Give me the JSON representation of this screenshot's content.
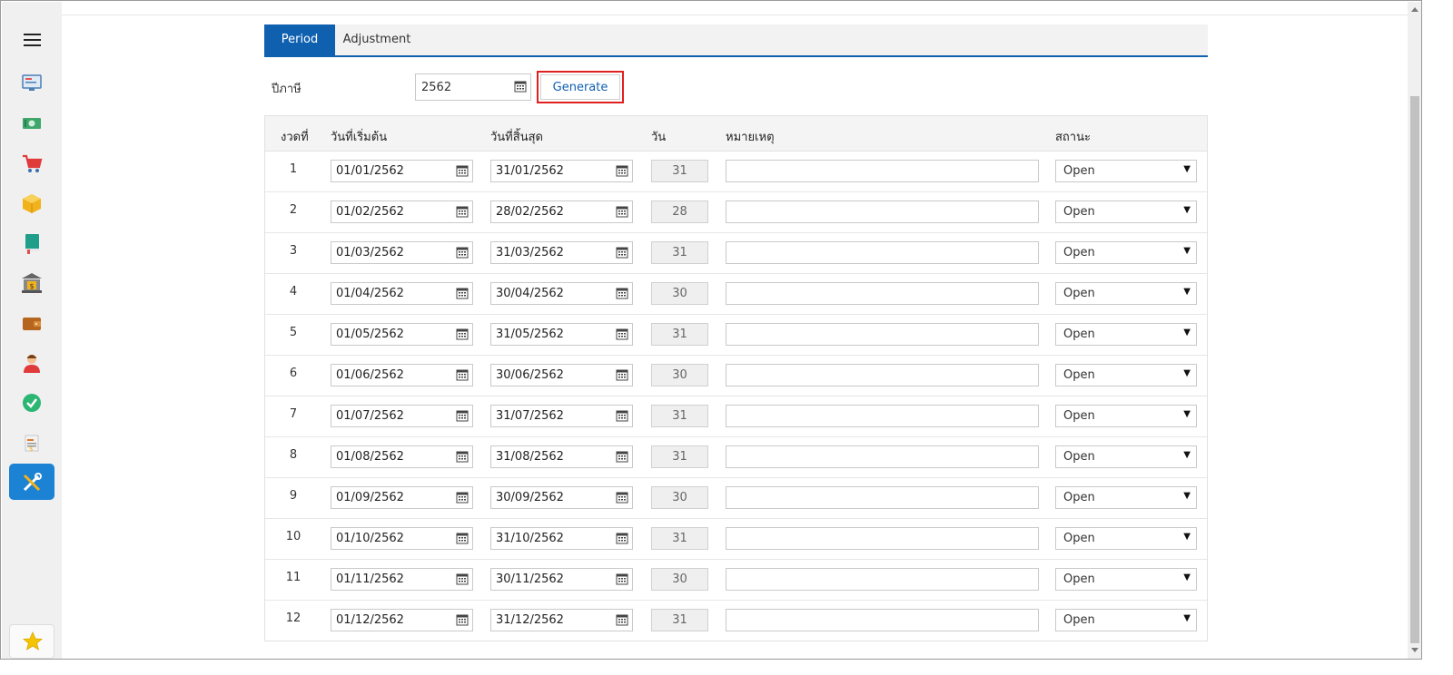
{
  "tabs": [
    {
      "label": "Period",
      "active": true
    },
    {
      "label": "Adjustment",
      "active": false
    }
  ],
  "form": {
    "year_label": "ปีภาษี",
    "year_value": "2562",
    "generate_label": "Generate"
  },
  "table": {
    "headers": {
      "no": "งวดที่",
      "start": "วันที่เริ่มต้น",
      "end": "วันที่สิ้นสุด",
      "days": "วัน",
      "note": "หมายเหตุ",
      "status": "สถานะ"
    },
    "rows": [
      {
        "no": "1",
        "start": "01/01/2562",
        "end": "31/01/2562",
        "days": "31",
        "note": "",
        "status": "Open"
      },
      {
        "no": "2",
        "start": "01/02/2562",
        "end": "28/02/2562",
        "days": "28",
        "note": "",
        "status": "Open"
      },
      {
        "no": "3",
        "start": "01/03/2562",
        "end": "31/03/2562",
        "days": "31",
        "note": "",
        "status": "Open"
      },
      {
        "no": "4",
        "start": "01/04/2562",
        "end": "30/04/2562",
        "days": "30",
        "note": "",
        "status": "Open"
      },
      {
        "no": "5",
        "start": "01/05/2562",
        "end": "31/05/2562",
        "days": "31",
        "note": "",
        "status": "Open"
      },
      {
        "no": "6",
        "start": "01/06/2562",
        "end": "30/06/2562",
        "days": "30",
        "note": "",
        "status": "Open"
      },
      {
        "no": "7",
        "start": "01/07/2562",
        "end": "31/07/2562",
        "days": "31",
        "note": "",
        "status": "Open"
      },
      {
        "no": "8",
        "start": "01/08/2562",
        "end": "31/08/2562",
        "days": "31",
        "note": "",
        "status": "Open"
      },
      {
        "no": "9",
        "start": "01/09/2562",
        "end": "30/09/2562",
        "days": "30",
        "note": "",
        "status": "Open"
      },
      {
        "no": "10",
        "start": "01/10/2562",
        "end": "31/10/2562",
        "days": "31",
        "note": "",
        "status": "Open"
      },
      {
        "no": "11",
        "start": "01/11/2562",
        "end": "30/11/2562",
        "days": "30",
        "note": "",
        "status": "Open"
      },
      {
        "no": "12",
        "start": "01/12/2562",
        "end": "31/12/2562",
        "days": "31",
        "note": "",
        "status": "Open"
      }
    ]
  },
  "sidebar": {
    "icons": [
      "menu-icon",
      "monitor-icon",
      "money-icon",
      "cart-icon",
      "box-icon",
      "book-icon",
      "bank-icon",
      "wallet-icon",
      "user-icon",
      "check-icon",
      "document-icon",
      "tools-icon",
      "star-icon"
    ]
  },
  "colors": {
    "accent": "#1060b0",
    "sidebar_active": "#1c82d4",
    "highlight": "#e02020",
    "check": "#2bb673",
    "star": "#f5c400"
  }
}
